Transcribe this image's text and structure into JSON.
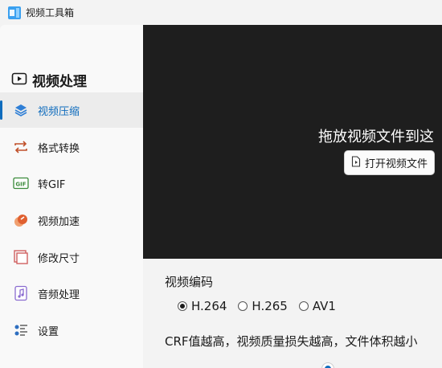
{
  "titlebar": {
    "app_title": "视频工具箱"
  },
  "sidebar": {
    "section_title": "视频处理",
    "items": [
      {
        "label": "视频压缩",
        "icon": "layers-icon",
        "active": true
      },
      {
        "label": "格式转换",
        "icon": "convert-arrows-icon",
        "active": false
      },
      {
        "label": "转GIF",
        "icon": "gif-icon",
        "active": false
      },
      {
        "label": "视频加速",
        "icon": "speed-icon",
        "active": false
      },
      {
        "label": "修改尺寸",
        "icon": "resize-icon",
        "active": false
      },
      {
        "label": "音频处理",
        "icon": "music-file-icon",
        "active": false
      },
      {
        "label": "设置",
        "icon": "settings-sliders-icon",
        "active": false
      }
    ]
  },
  "dropzone": {
    "text": "拖放视频文件到这",
    "open_button": "打开视频文件"
  },
  "settings": {
    "codec_label": "视频编码",
    "codec_options": [
      "H.264",
      "H.265",
      "AV1"
    ],
    "codec_selected": "H.264",
    "crf_note": "CRF值越高，视频质量损失越高，文件体积越小"
  },
  "colors": {
    "accent": "#0f6cbd",
    "dropzone_bg": "#1e1e1e"
  }
}
